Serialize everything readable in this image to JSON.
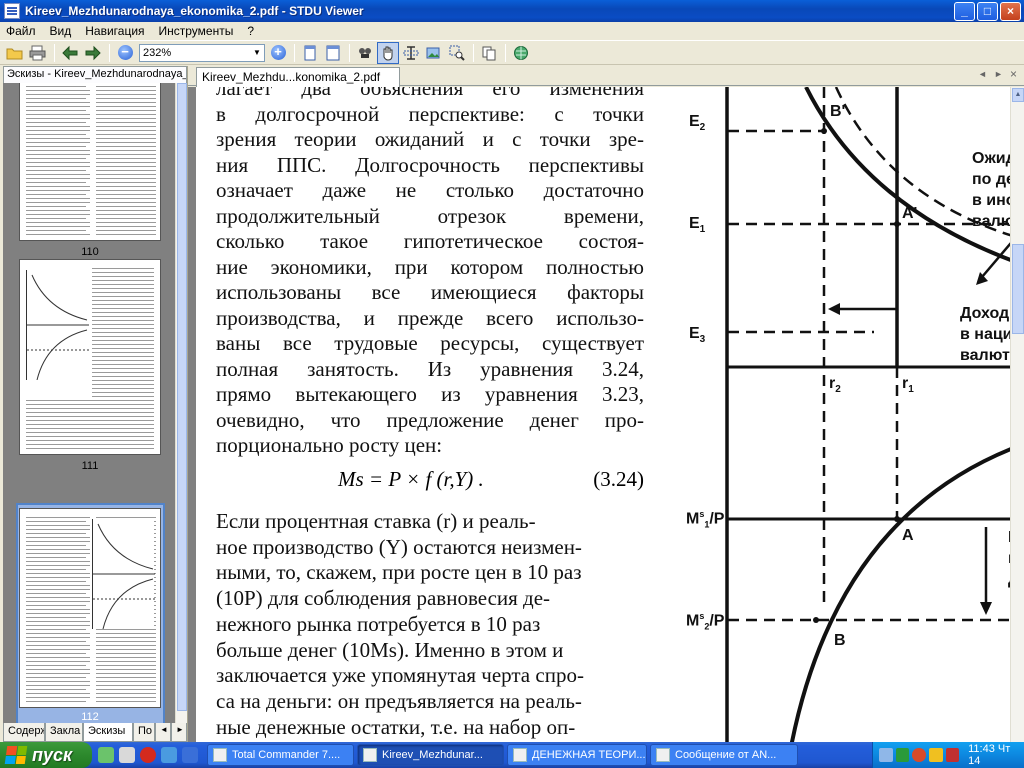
{
  "window": {
    "title": "Kireev_Mezhdunarodnaya_ekonomika_2.pdf - STDU Viewer",
    "min_label": "_",
    "max_label": "□",
    "close_label": "×"
  },
  "menu": [
    "Файл",
    "Вид",
    "Навигация",
    "Инструменты",
    "?"
  ],
  "toolbar": {
    "zoom_value": "232%",
    "zoom_out_label": "−",
    "zoom_in_label": "+"
  },
  "left_panel": {
    "tab_title": "Эскизы - Kireev_Mezhdunarodnaya_ekonomika_2.pdf",
    "thumbnails": [
      {
        "page_label": "110"
      },
      {
        "page_label": "111"
      },
      {
        "page_label": "112",
        "selected": true
      }
    ],
    "bottom_tabs": [
      "Содерж",
      "Закла",
      "Эскизы",
      "По"
    ]
  },
  "document": {
    "tab_label": "Kireev_Mezhdu...konomika_2.pdf",
    "text_lines": [
      "лагает два объяснения его изменения",
      "в долгосрочной перспективе: с точки",
      "зрения теории ожиданий и с точки зре-",
      "ния ППС. Долгосрочность перспективы",
      "означает даже не столько достаточно",
      "продолжительный отрезок времени,",
      "сколько такое гипотетическое состоя-",
      "ние экономики, при котором полностью",
      "использованы все имеющиеся факторы",
      "производства, и прежде всего использо-",
      "ваны все трудовые ресурсы, существует",
      "полная занятость. Из уравнения 3.24,",
      "прямо вытекающего из уравнения 3.23,",
      "очевидно, что предложение денег про-",
      "порционально росту цен:"
    ],
    "formula": "Ms = P × f (r,Y) .",
    "formula_number": "(3.24)",
    "para2_lines": [
      "Если процентная ставка (r) и реаль-",
      "ное производство (Y) остаются неизмен-",
      "ными, то, скажем, при росте цен в 10 раз",
      "(10P) для соблюдения равновесия де-",
      "нежного рынка потребуется в 10 раз",
      "больше денег (10Ms). Именно в этом и",
      "заключается уже упомянутая черта спро-",
      "са на деньги: он предъявляется на реаль-",
      "ные денежные остатки, т.е. на набор оп-"
    ],
    "graph_labels": {
      "e2": "E",
      "e2_sub": "2",
      "e1": "E",
      "e1_sub": "1",
      "e3": "E",
      "e3_sub": "3",
      "b_prime": "B'",
      "a_prime": "A'",
      "r2": "r",
      "r2_sub": "2",
      "r1": "r",
      "r1_sub": "1",
      "m1": "M",
      "m1_tail": "/P",
      "m2": "M",
      "m2_tail": "/P",
      "a": "A",
      "b": "B",
      "note1": [
        "Ожид",
        "по де",
        "в инос",
        "валю"
      ],
      "note2": [
        "Доход",
        "в наци",
        "валют"
      ],
      "note3": [
        "Р",
        "п",
        "д"
      ]
    }
  },
  "taskbar": {
    "start_label": "пуск",
    "tasks": [
      "Total Commander 7....",
      "Kireev_Mezhdunar...",
      "ДЕНЕЖНАЯ ТЕОРИ...",
      "Сообщение от AN..."
    ],
    "clock": "11:43 Чт 14"
  }
}
